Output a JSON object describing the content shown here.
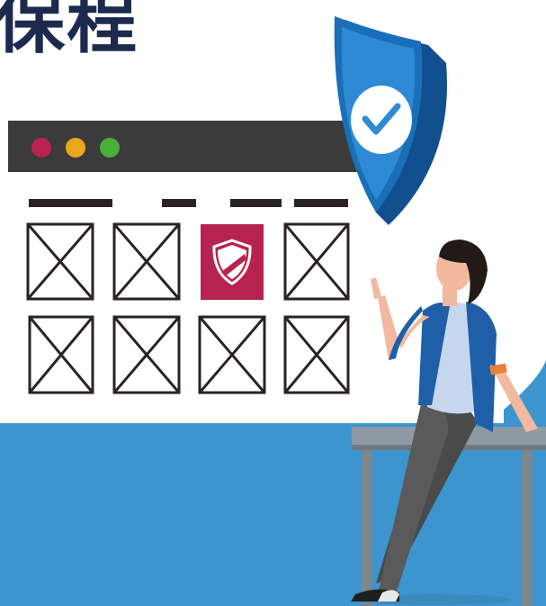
{
  "header": {
    "title_partial": "保程"
  },
  "window": {
    "dots": [
      {
        "color": "#b72351"
      },
      {
        "color": "#e8a81c"
      },
      {
        "color": "#4cae3c"
      }
    ],
    "bar_color": "#3b3b3b"
  },
  "grid": {
    "placeholder_icon": "image-placeholder-icon",
    "highlight_icon": "shield-icon",
    "highlight_color": "#b72351"
  },
  "shield": {
    "icon": "shield-check-icon",
    "color": "#1a6fb8"
  },
  "scene": {
    "background_color": "#3c95cf",
    "person": "woman-pointing-figure",
    "bench": "bench-icon"
  }
}
